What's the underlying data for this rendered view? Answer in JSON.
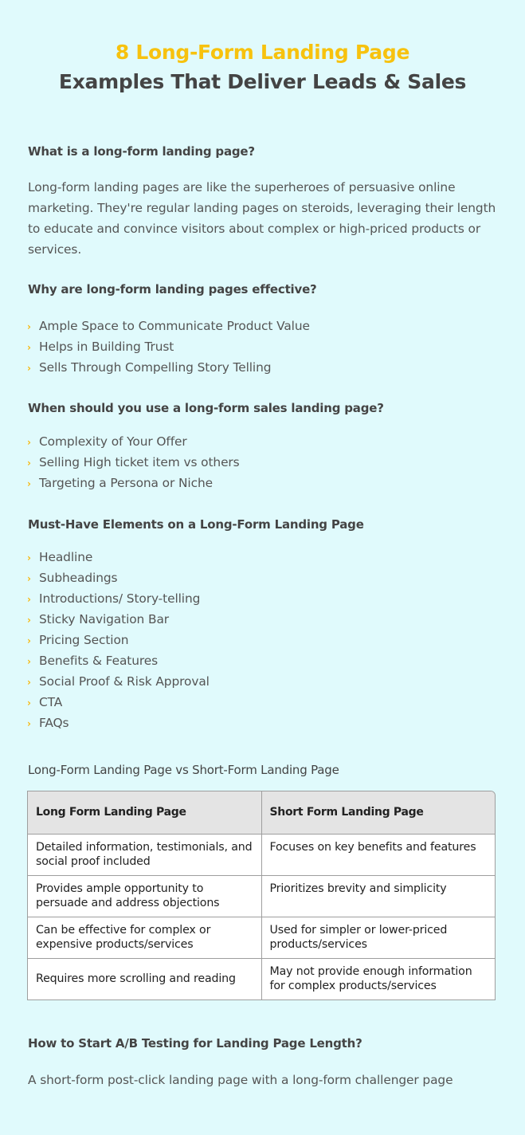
{
  "title": {
    "line1": "8 Long-Form Landing Page",
    "line2": "Examples That Deliver Leads & Sales",
    "accent_color": "#f7c20e"
  },
  "sections": {
    "what": {
      "heading": "What is a long-form landing page?",
      "body": "Long-form landing pages are like the superheroes of persuasive online marketing. They're regular landing pages on steroids, leveraging their length to educate and convince visitors about complex or high-priced products or services."
    },
    "why": {
      "heading": "Why are long-form landing pages effective?",
      "items": [
        "Ample Space to Communicate Product Value",
        "Helps in Building Trust",
        "Sells Through Compelling Story Telling"
      ]
    },
    "when": {
      "heading": "When should you use a long-form sales landing page?",
      "items": [
        "Complexity of Your Offer",
        "Selling High ticket item vs others",
        "Targeting a Persona or Niche"
      ]
    },
    "elements": {
      "heading": "Must-Have Elements on a Long-Form Landing Page",
      "items": [
        "Headline",
        "Subheadings",
        "Introductions/ Story-telling",
        "Sticky Navigation Bar",
        "Pricing Section",
        "Benefits & Features",
        "Social Proof & Risk Approval",
        "CTA",
        "FAQs"
      ]
    },
    "comparison": {
      "heading": "Long-Form Landing Page vs Short-Form Landing Page",
      "columns": [
        "Long Form Landing Page",
        "Short Form Landing Page"
      ],
      "rows": [
        [
          "Detailed information, testimonials, and social proof included",
          "Focuses on key benefits and features"
        ],
        [
          "Provides ample opportunity to persuade and address objections",
          "Prioritizes brevity and simplicity"
        ],
        [
          "Can be effective for complex or expensive products/services",
          "Used for simpler or lower-priced products/services"
        ],
        [
          "Requires more scrolling and reading",
          "May not provide enough information for complex products/services"
        ]
      ]
    },
    "abtest": {
      "heading": "How to Start A/B Testing for Landing Page Length?",
      "body": "A short-form post-click landing page with a long-form challenger page"
    }
  },
  "icons": {
    "bullet": "chevron-right-icon",
    "bullet_glyph": "›",
    "bullet_color": "#f7b80e"
  }
}
